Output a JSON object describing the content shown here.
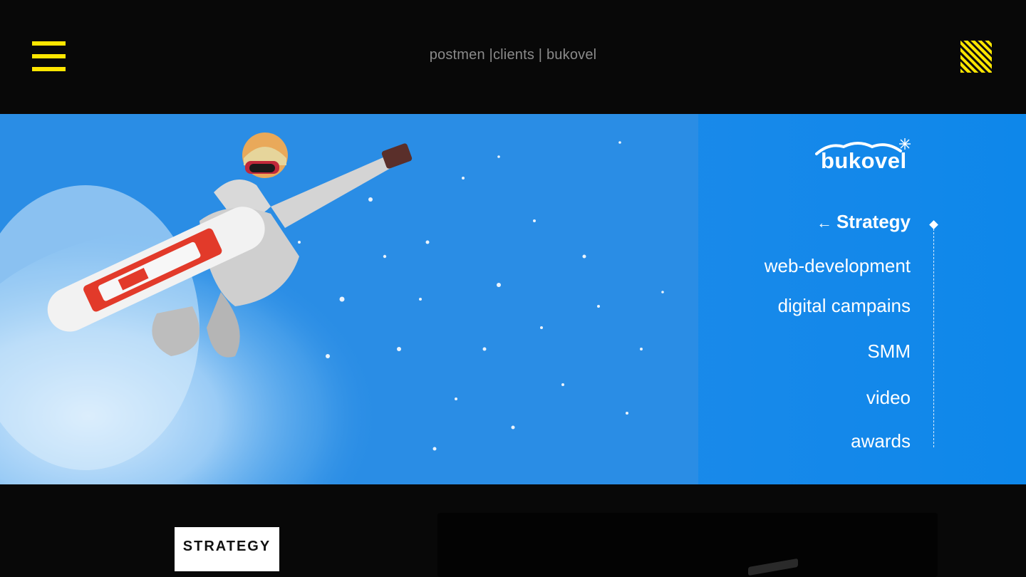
{
  "header": {
    "menu_icon": "hamburger-icon",
    "breadcrumb": {
      "part1": "postmen |",
      "part2": "clients",
      "sep": " | ",
      "part3": "bukovel"
    },
    "stripes_icon": "pattern-icon",
    "accent_color": "#ffe600"
  },
  "hero": {
    "logo_text": "bukovel",
    "logo_icon": "snowflake-icon",
    "image_subject": "snowboarder-photo",
    "background_color": "#0e87ea",
    "nav": [
      {
        "label": "Strategy",
        "active": true,
        "icon": "arrow-left-icon",
        "arrow": "←"
      },
      {
        "label": "web-development"
      },
      {
        "label": "digital campains"
      },
      {
        "label": "SMM"
      },
      {
        "label": "video"
      },
      {
        "label": "awards"
      }
    ]
  },
  "content": {
    "section_tag": "STRATEGY"
  }
}
